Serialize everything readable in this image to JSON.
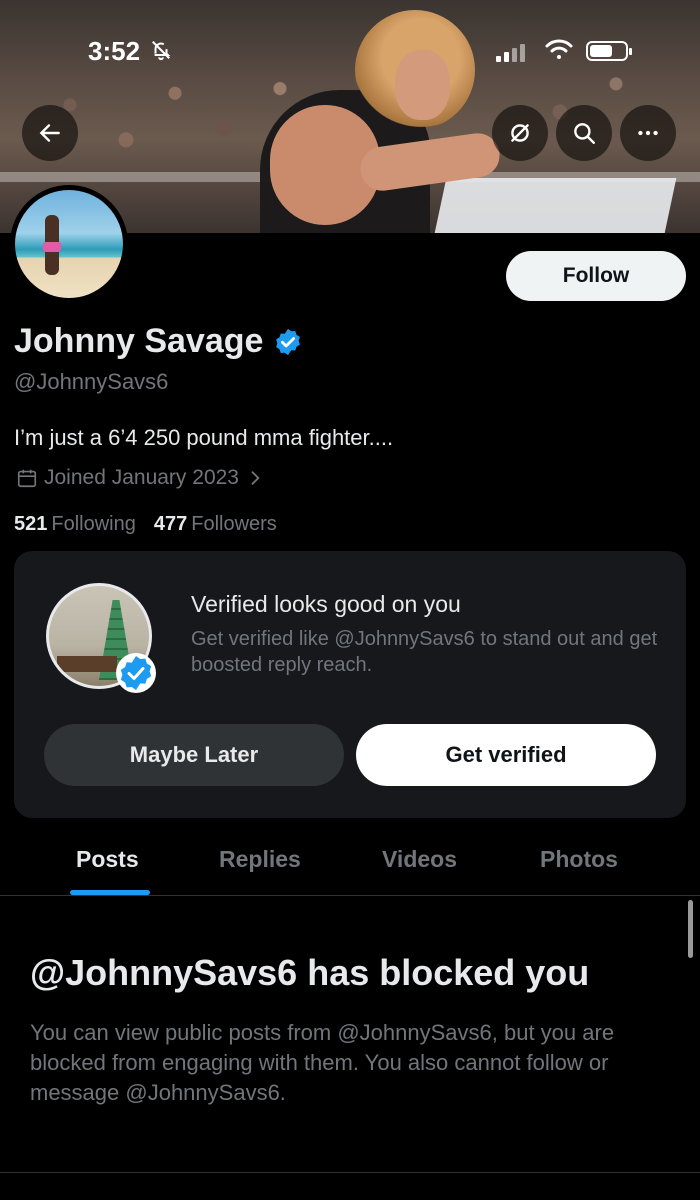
{
  "status_bar": {
    "time": "3:52"
  },
  "profile": {
    "name": "Johnny Savage",
    "handle": "@JohnnySavs6",
    "bio": "I’m just a 6’4 250 pound mma fighter....",
    "joined": "Joined January 2023",
    "following_count": "521",
    "following_label": "Following",
    "followers_count": "477",
    "followers_label": "Followers",
    "follow_label": "Follow"
  },
  "promo": {
    "title": "Verified looks good on you",
    "description": "Get verified like @JohnnySavs6 to stand out and get boosted reply reach.",
    "maybe_later_label": "Maybe Later",
    "get_verified_label": "Get verified"
  },
  "tabs": [
    {
      "label": "Posts",
      "active": true
    },
    {
      "label": "Replies",
      "active": false
    },
    {
      "label": "Videos",
      "active": false
    },
    {
      "label": "Photos",
      "active": false
    }
  ],
  "blocked": {
    "title": "@JohnnySavs6 has blocked you",
    "description": "You can view public posts from @JohnnySavs6, but you are blocked from engaging with them. You also cannot follow or message @JohnnySavs6."
  },
  "colors": {
    "accent": "#1d9bf0",
    "background": "#000000",
    "card": "#16181c",
    "muted_text": "#71767b"
  },
  "icons": [
    "back-arrow-icon",
    "no-notifications-icon",
    "search-icon",
    "more-icon",
    "verified-badge-icon",
    "calendar-icon",
    "chevron-right-icon"
  ]
}
